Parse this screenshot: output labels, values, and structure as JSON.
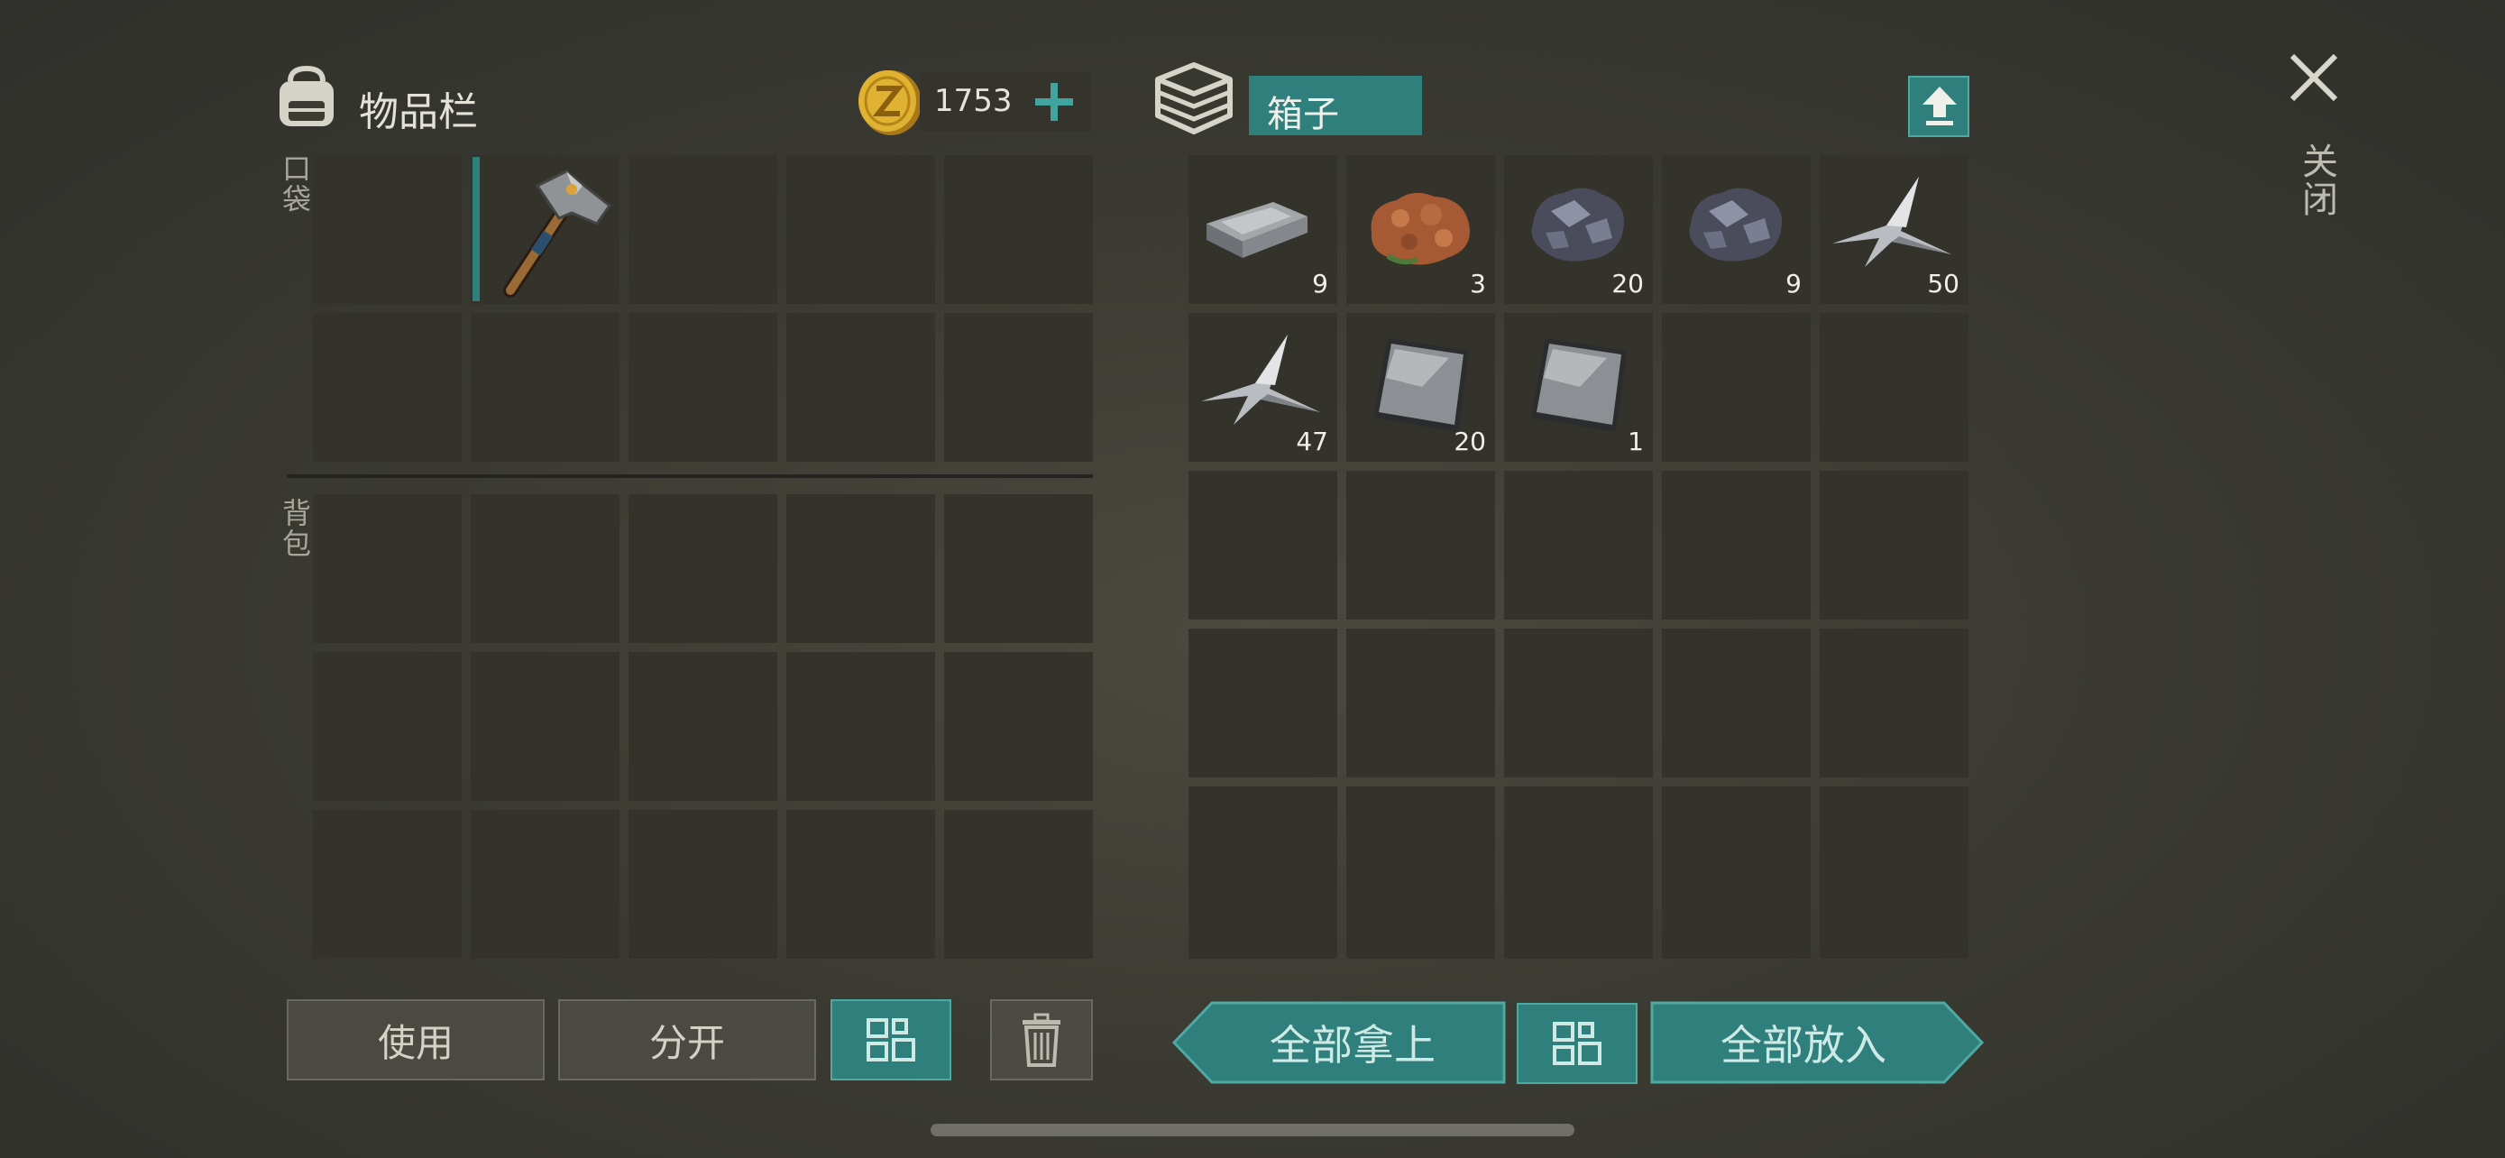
{
  "inventory": {
    "title": "物品栏",
    "coins": "1753",
    "pocket_label": "口袋",
    "backpack_label": "背包"
  },
  "box": {
    "title": "箱子",
    "items": [
      {
        "icon": "iron-ingot-icon",
        "count": "9"
      },
      {
        "icon": "copper-ore-icon",
        "count": "3"
      },
      {
        "icon": "iron-ore-icon",
        "count": "20"
      },
      {
        "icon": "iron-ore-icon",
        "count": "9"
      },
      {
        "icon": "metal-scrap-icon",
        "count": "50"
      },
      {
        "icon": "metal-scrap-icon",
        "count": "47"
      },
      {
        "icon": "metal-plate-icon",
        "count": "20"
      },
      {
        "icon": "metal-plate-icon",
        "count": "1"
      }
    ]
  },
  "buttons": {
    "use": "使用",
    "split": "分开",
    "take_all": "全部拿上",
    "put_all": "全部放入"
  },
  "close_label": "关闭",
  "colors": {
    "accent": "#2f7f7c",
    "slot": "#33332c",
    "coin": "#d8a92a"
  }
}
